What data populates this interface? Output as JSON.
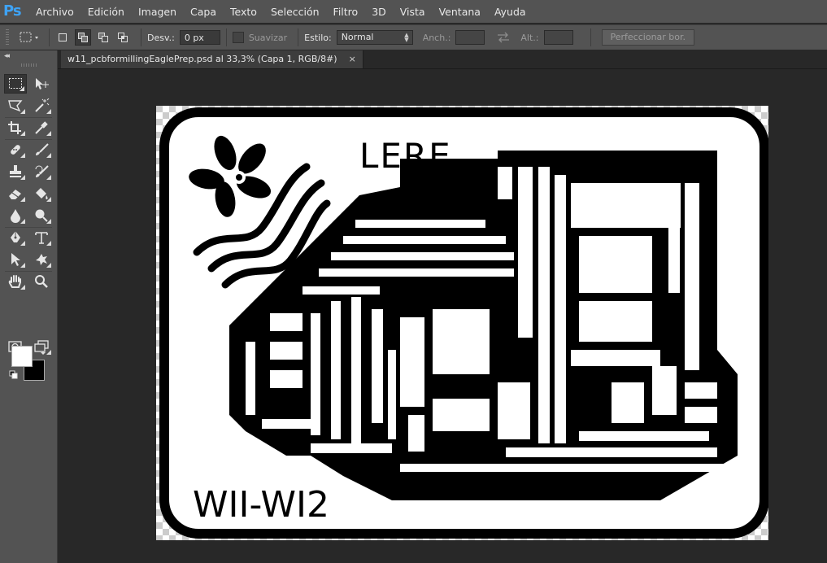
{
  "app": {
    "logo": "Ps"
  },
  "menu": [
    "Archivo",
    "Edición",
    "Imagen",
    "Capa",
    "Texto",
    "Selección",
    "Filtro",
    "3D",
    "Vista",
    "Ventana",
    "Ayuda"
  ],
  "options": {
    "feather_label": "Desv.:",
    "feather_value": "0 px",
    "antialias_label": "Suavizar",
    "style_label": "Estilo:",
    "style_value": "Normal",
    "width_label": "Anch.:",
    "height_label": "Alt.:",
    "refine_label": "Perfeccionar bor."
  },
  "document": {
    "tab_title": "w11_pcbformillingEaglePrep.psd al 33,3% (Capa 1, RGB/8#)",
    "close_glyph": "×",
    "pcb_text_top": "LERE",
    "pcb_text_bottom": "WII-WI2"
  },
  "colors": {
    "foreground": "#ffffff",
    "background": "#000000",
    "ui_panel": "#535353",
    "workspace": "#282828",
    "logo_blue": "#3ea3f5"
  },
  "tools": [
    "rectangular-marquee-icon",
    "move-icon",
    "lasso-icon",
    "magic-wand-icon",
    "crop-icon",
    "eyedropper-icon",
    "healing-brush-icon",
    "brush-icon",
    "clone-stamp-icon",
    "history-brush-icon",
    "eraser-icon",
    "paint-bucket-icon",
    "blur-icon",
    "dodge-icon",
    "pen-icon",
    "type-icon",
    "path-selection-icon",
    "custom-shape-icon",
    "hand-icon",
    "zoom-icon",
    "quick-mask-icon",
    "screen-mode-icon"
  ]
}
